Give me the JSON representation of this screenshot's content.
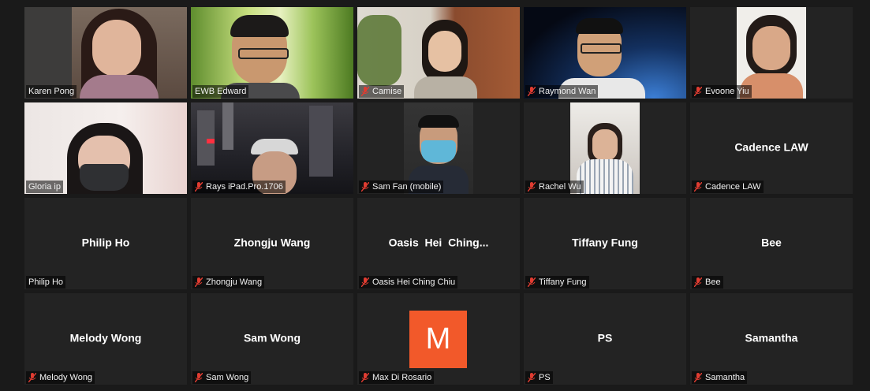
{
  "participants": [
    {
      "label": "Karen Pong",
      "muted": false,
      "video": true
    },
    {
      "label": "EWB Edward",
      "muted": false,
      "video": true
    },
    {
      "label": "Camise",
      "muted": true,
      "video": true
    },
    {
      "label": "Raymond Wan",
      "muted": true,
      "video": true
    },
    {
      "label": "Evoone Yiu",
      "muted": true,
      "video": true
    },
    {
      "label": "Gloria ip",
      "muted": false,
      "video": true,
      "active_speaker": true
    },
    {
      "label": "Rays iPad.Pro.1706",
      "muted": true,
      "video": true
    },
    {
      "label": "Sam Fan (mobile)",
      "muted": true,
      "video": true
    },
    {
      "label": "Rachel Wu",
      "muted": true,
      "video": true
    },
    {
      "label": "Cadence LAW",
      "display_name": "Cadence LAW",
      "muted": true,
      "video": false
    },
    {
      "label": "Philip Ho",
      "display_name": "Philip Ho",
      "muted": false,
      "video": false
    },
    {
      "label": "Zhongju Wang",
      "display_name": "Zhongju Wang",
      "muted": true,
      "video": false
    },
    {
      "label": "Oasis Hei Ching Chiu",
      "display_name": "Oasis  Hei  Ching...",
      "muted": true,
      "video": false
    },
    {
      "label": "Tiffany Fung",
      "display_name": "Tiffany Fung",
      "muted": true,
      "video": false
    },
    {
      "label": "Bee",
      "display_name": "Bee",
      "muted": true,
      "video": false
    },
    {
      "label": "Melody Wong",
      "display_name": "Melody Wong",
      "muted": true,
      "video": false
    },
    {
      "label": "Sam Wong",
      "display_name": "Sam Wong",
      "muted": true,
      "video": false
    },
    {
      "label": "Max Di Rosario",
      "avatar_letter": "M",
      "muted": true,
      "video": false
    },
    {
      "label": "PS",
      "display_name": "PS",
      "muted": true,
      "video": false
    },
    {
      "label": "Samantha",
      "display_name": "Samantha",
      "muted": true,
      "video": false
    }
  ],
  "colors": {
    "background": "#1a1a1a",
    "tile": "#232323",
    "active_border": "#dfe884",
    "mute_icon": "#e03c31",
    "avatar": "#f2592a"
  }
}
